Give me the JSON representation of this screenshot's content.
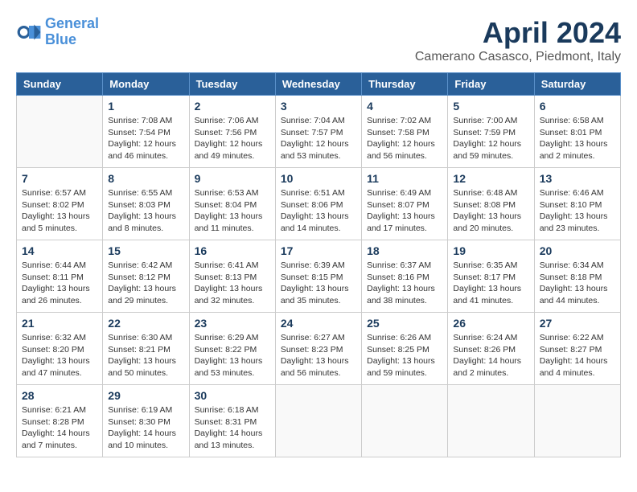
{
  "logo": {
    "text1": "General",
    "text2": "Blue"
  },
  "title": "April 2024",
  "location": "Camerano Casasco, Piedmont, Italy",
  "weekdays": [
    "Sunday",
    "Monday",
    "Tuesday",
    "Wednesday",
    "Thursday",
    "Friday",
    "Saturday"
  ],
  "weeks": [
    [
      {
        "day": "",
        "info": ""
      },
      {
        "day": "1",
        "info": "Sunrise: 7:08 AM\nSunset: 7:54 PM\nDaylight: 12 hours\nand 46 minutes."
      },
      {
        "day": "2",
        "info": "Sunrise: 7:06 AM\nSunset: 7:56 PM\nDaylight: 12 hours\nand 49 minutes."
      },
      {
        "day": "3",
        "info": "Sunrise: 7:04 AM\nSunset: 7:57 PM\nDaylight: 12 hours\nand 53 minutes."
      },
      {
        "day": "4",
        "info": "Sunrise: 7:02 AM\nSunset: 7:58 PM\nDaylight: 12 hours\nand 56 minutes."
      },
      {
        "day": "5",
        "info": "Sunrise: 7:00 AM\nSunset: 7:59 PM\nDaylight: 12 hours\nand 59 minutes."
      },
      {
        "day": "6",
        "info": "Sunrise: 6:58 AM\nSunset: 8:01 PM\nDaylight: 13 hours\nand 2 minutes."
      }
    ],
    [
      {
        "day": "7",
        "info": "Sunrise: 6:57 AM\nSunset: 8:02 PM\nDaylight: 13 hours\nand 5 minutes."
      },
      {
        "day": "8",
        "info": "Sunrise: 6:55 AM\nSunset: 8:03 PM\nDaylight: 13 hours\nand 8 minutes."
      },
      {
        "day": "9",
        "info": "Sunrise: 6:53 AM\nSunset: 8:04 PM\nDaylight: 13 hours\nand 11 minutes."
      },
      {
        "day": "10",
        "info": "Sunrise: 6:51 AM\nSunset: 8:06 PM\nDaylight: 13 hours\nand 14 minutes."
      },
      {
        "day": "11",
        "info": "Sunrise: 6:49 AM\nSunset: 8:07 PM\nDaylight: 13 hours\nand 17 minutes."
      },
      {
        "day": "12",
        "info": "Sunrise: 6:48 AM\nSunset: 8:08 PM\nDaylight: 13 hours\nand 20 minutes."
      },
      {
        "day": "13",
        "info": "Sunrise: 6:46 AM\nSunset: 8:10 PM\nDaylight: 13 hours\nand 23 minutes."
      }
    ],
    [
      {
        "day": "14",
        "info": "Sunrise: 6:44 AM\nSunset: 8:11 PM\nDaylight: 13 hours\nand 26 minutes."
      },
      {
        "day": "15",
        "info": "Sunrise: 6:42 AM\nSunset: 8:12 PM\nDaylight: 13 hours\nand 29 minutes."
      },
      {
        "day": "16",
        "info": "Sunrise: 6:41 AM\nSunset: 8:13 PM\nDaylight: 13 hours\nand 32 minutes."
      },
      {
        "day": "17",
        "info": "Sunrise: 6:39 AM\nSunset: 8:15 PM\nDaylight: 13 hours\nand 35 minutes."
      },
      {
        "day": "18",
        "info": "Sunrise: 6:37 AM\nSunset: 8:16 PM\nDaylight: 13 hours\nand 38 minutes."
      },
      {
        "day": "19",
        "info": "Sunrise: 6:35 AM\nSunset: 8:17 PM\nDaylight: 13 hours\nand 41 minutes."
      },
      {
        "day": "20",
        "info": "Sunrise: 6:34 AM\nSunset: 8:18 PM\nDaylight: 13 hours\nand 44 minutes."
      }
    ],
    [
      {
        "day": "21",
        "info": "Sunrise: 6:32 AM\nSunset: 8:20 PM\nDaylight: 13 hours\nand 47 minutes."
      },
      {
        "day": "22",
        "info": "Sunrise: 6:30 AM\nSunset: 8:21 PM\nDaylight: 13 hours\nand 50 minutes."
      },
      {
        "day": "23",
        "info": "Sunrise: 6:29 AM\nSunset: 8:22 PM\nDaylight: 13 hours\nand 53 minutes."
      },
      {
        "day": "24",
        "info": "Sunrise: 6:27 AM\nSunset: 8:23 PM\nDaylight: 13 hours\nand 56 minutes."
      },
      {
        "day": "25",
        "info": "Sunrise: 6:26 AM\nSunset: 8:25 PM\nDaylight: 13 hours\nand 59 minutes."
      },
      {
        "day": "26",
        "info": "Sunrise: 6:24 AM\nSunset: 8:26 PM\nDaylight: 14 hours\nand 2 minutes."
      },
      {
        "day": "27",
        "info": "Sunrise: 6:22 AM\nSunset: 8:27 PM\nDaylight: 14 hours\nand 4 minutes."
      }
    ],
    [
      {
        "day": "28",
        "info": "Sunrise: 6:21 AM\nSunset: 8:28 PM\nDaylight: 14 hours\nand 7 minutes."
      },
      {
        "day": "29",
        "info": "Sunrise: 6:19 AM\nSunset: 8:30 PM\nDaylight: 14 hours\nand 10 minutes."
      },
      {
        "day": "30",
        "info": "Sunrise: 6:18 AM\nSunset: 8:31 PM\nDaylight: 14 hours\nand 13 minutes."
      },
      {
        "day": "",
        "info": ""
      },
      {
        "day": "",
        "info": ""
      },
      {
        "day": "",
        "info": ""
      },
      {
        "day": "",
        "info": ""
      }
    ]
  ]
}
